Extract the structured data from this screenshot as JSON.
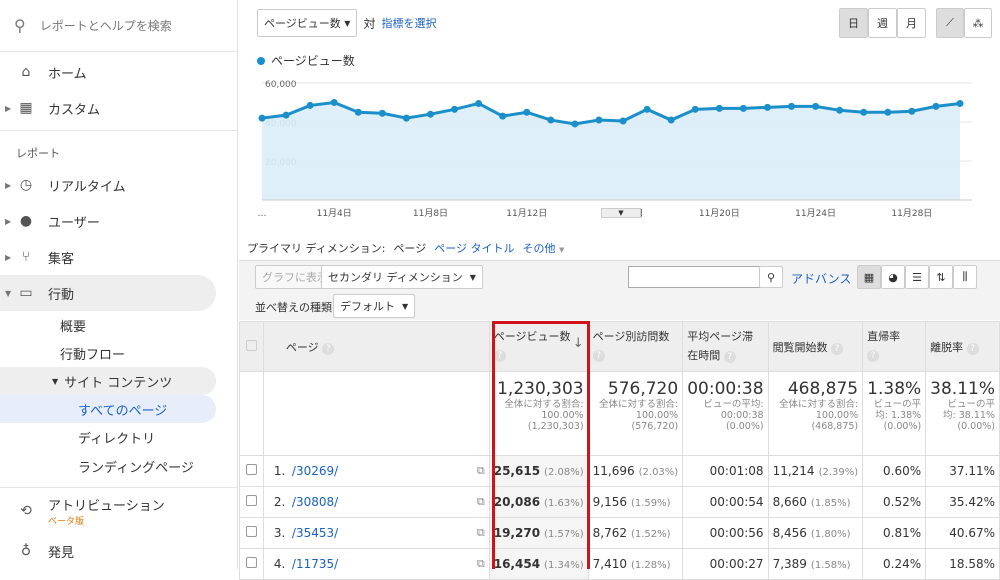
{
  "sidebar": {
    "search_placeholder": "レポートとヘルプを検索",
    "home": "ホーム",
    "custom": "カスタム",
    "section": "レポート",
    "realtime": "リアルタイム",
    "audience": "ユーザー",
    "acquisition": "集客",
    "behavior": "行動",
    "behavior_sub": [
      "概要",
      "行動フロー"
    ],
    "site_content": "サイト コンテンツ",
    "site_content_sub": [
      "すべてのページ",
      "ディレクトリ",
      "ランディングページ"
    ],
    "attribution": "アトリビューション",
    "attribution_badge": "ベータ版",
    "discover": "発見"
  },
  "toolbar": {
    "metric_select": "ページビュー数",
    "vs": "対",
    "select_metric": "指標を選択",
    "periods": [
      "日",
      "週",
      "月"
    ],
    "active_period": "日"
  },
  "chart_data": {
    "type": "area",
    "series": [
      {
        "name": "ページビュー数",
        "color": "#1a8fc9",
        "values": [
          42000,
          43500,
          48500,
          50000,
          45000,
          44500,
          42000,
          44000,
          46500,
          49500,
          43000,
          45000,
          41000,
          39000,
          41000,
          40500,
          46500,
          41000,
          46500,
          47000,
          47000,
          47500,
          48000,
          48000,
          46000,
          45000,
          45000,
          45500,
          48000,
          49500
        ]
      }
    ],
    "x_tick_labels": [
      "…",
      "11月4日",
      "11月8日",
      "11月12日",
      "11月16日",
      "11月20日",
      "11月24日",
      "11月28日"
    ],
    "y_tick_labels": [
      "20,000",
      "40,000",
      "60,000"
    ],
    "ylim": [
      0,
      60000
    ],
    "grid": true
  },
  "dimension": {
    "label": "プライマリ ディメンション:",
    "current": "ページ",
    "page_title": "ページ タイトル",
    "other": "その他"
  },
  "controls": {
    "plot_rows": "グラフに表示",
    "secondary": "セカンダリ ディメンション",
    "advanced": "アドバンス",
    "sort_label": "並べ替えの種類:",
    "sort_value": "デフォルト"
  },
  "table": {
    "headers": [
      "ページ",
      "ページビュー数",
      "ページ別訪問数",
      "平均ページ滞在時間",
      "閲覧開始数",
      "直帰率",
      "離脱率"
    ],
    "totals": [
      {
        "v": "1,230,303",
        "s": "全体に対する割合: 100.00% (1,230,303)"
      },
      {
        "v": "576,720",
        "s": "全体に対する割合: 100.00% (576,720)"
      },
      {
        "v": "00:00:38",
        "s": "ビューの平均: 00:00:38 (0.00%)"
      },
      {
        "v": "468,875",
        "s": "全体に対する割合: 100.00% (468,875)"
      },
      {
        "v": "1.38%",
        "s": "ビューの平均: 1.38% (0.00%)"
      },
      {
        "v": "38.11%",
        "s": "ビューの平均: 38.11% (0.00%)"
      }
    ],
    "rows": [
      {
        "n": "1.",
        "page": "/30269/",
        "pv": "25,615",
        "pvp": "(2.08%)",
        "uv": "11,696",
        "uvp": "(2.03%)",
        "time": "00:01:08",
        "ent": "11,214",
        "entp": "(2.39%)",
        "bounce": "0.60%",
        "exit": "37.11%"
      },
      {
        "n": "2.",
        "page": "/30808/",
        "pv": "20,086",
        "pvp": "(1.63%)",
        "uv": "9,156",
        "uvp": "(1.59%)",
        "time": "00:00:54",
        "ent": "8,660",
        "entp": "(1.85%)",
        "bounce": "0.52%",
        "exit": "35.42%"
      },
      {
        "n": "3.",
        "page": "/35453/",
        "pv": "19,270",
        "pvp": "(1.57%)",
        "uv": "8,762",
        "uvp": "(1.52%)",
        "time": "00:00:56",
        "ent": "8,456",
        "entp": "(1.80%)",
        "bounce": "0.81%",
        "exit": "40.67%"
      },
      {
        "n": "4.",
        "page": "/11735/",
        "pv": "16,454",
        "pvp": "(1.34%)",
        "uv": "7,410",
        "uvp": "(1.28%)",
        "time": "00:00:27",
        "ent": "7,389",
        "entp": "(1.58%)",
        "bounce": "0.24%",
        "exit": "18.58%"
      }
    ]
  },
  "highlight_color": "#d0121b"
}
